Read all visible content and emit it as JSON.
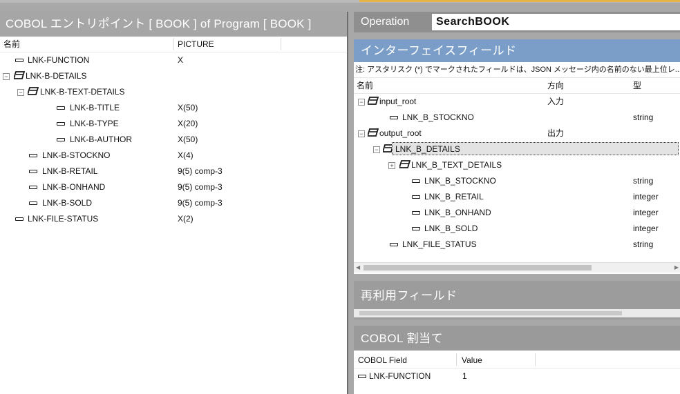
{
  "left_panel": {
    "title": "COBOL エントリポイント [ BOOK ] of Program [ BOOK ]",
    "columns": {
      "name": "名前",
      "picture": "PICTURE"
    },
    "rows": [
      {
        "name": "LNK-FUNCTION",
        "picture": "X"
      },
      {
        "name": "LNK-B-DETAILS",
        "picture": ""
      },
      {
        "name": "LNK-B-TEXT-DETAILS",
        "picture": ""
      },
      {
        "name": "LNK-B-TITLE",
        "picture": "X(50)"
      },
      {
        "name": "LNK-B-TYPE",
        "picture": "X(20)"
      },
      {
        "name": "LNK-B-AUTHOR",
        "picture": "X(50)"
      },
      {
        "name": "LNK-B-STOCKNO",
        "picture": "X(4)"
      },
      {
        "name": "LNK-B-RETAIL",
        "picture": "9(5) comp-3"
      },
      {
        "name": "LNK-B-ONHAND",
        "picture": "9(5) comp-3"
      },
      {
        "name": "LNK-B-SOLD",
        "picture": "9(5) comp-3"
      },
      {
        "name": "LNK-FILE-STATUS",
        "picture": "X(2)"
      }
    ]
  },
  "operation": {
    "label": "Operation",
    "value": "SearchBOOK"
  },
  "interface_panel": {
    "title": "インターフェイスフィールド",
    "note": "注: アスタリスク (*) でマークされたフィールドは、JSON メッセージ内の名前のない最上位レ...",
    "columns": {
      "name": "名前",
      "direction": "方向",
      "type": "型"
    },
    "rows": [
      {
        "name": "input_root",
        "direction": "入力",
        "type": ""
      },
      {
        "name": "LNK_B_STOCKNO",
        "direction": "",
        "type": "string"
      },
      {
        "name": "output_root",
        "direction": "出力",
        "type": ""
      },
      {
        "name": "LNK_B_DETAILS",
        "direction": "",
        "type": ""
      },
      {
        "name": "LNK_B_TEXT_DETAILS",
        "direction": "",
        "type": ""
      },
      {
        "name": "LNK_B_STOCKNO",
        "direction": "",
        "type": "string"
      },
      {
        "name": "LNK_B_RETAIL",
        "direction": "",
        "type": "integer"
      },
      {
        "name": "LNK_B_ONHAND",
        "direction": "",
        "type": "integer"
      },
      {
        "name": "LNK_B_SOLD",
        "direction": "",
        "type": "integer"
      },
      {
        "name": "LNK_FILE_STATUS",
        "direction": "",
        "type": "string"
      }
    ]
  },
  "reuse_panel": {
    "title": "再利用フィールド"
  },
  "cobol_panel": {
    "title": "COBOL 割当て",
    "columns": {
      "field": "COBOL Field",
      "value": "Value"
    },
    "rows": [
      {
        "field": "LNK-FUNCTION",
        "value": "1"
      }
    ]
  },
  "icons": {
    "field": "field-icon",
    "group": "group-icon",
    "expand": "expand-toggle-icon",
    "collapse": "collapse-toggle-icon"
  },
  "colors": {
    "interface_header": "#7b9ec9",
    "panel_header": "#9a9a9a",
    "top_accent": "#e6b24a"
  }
}
